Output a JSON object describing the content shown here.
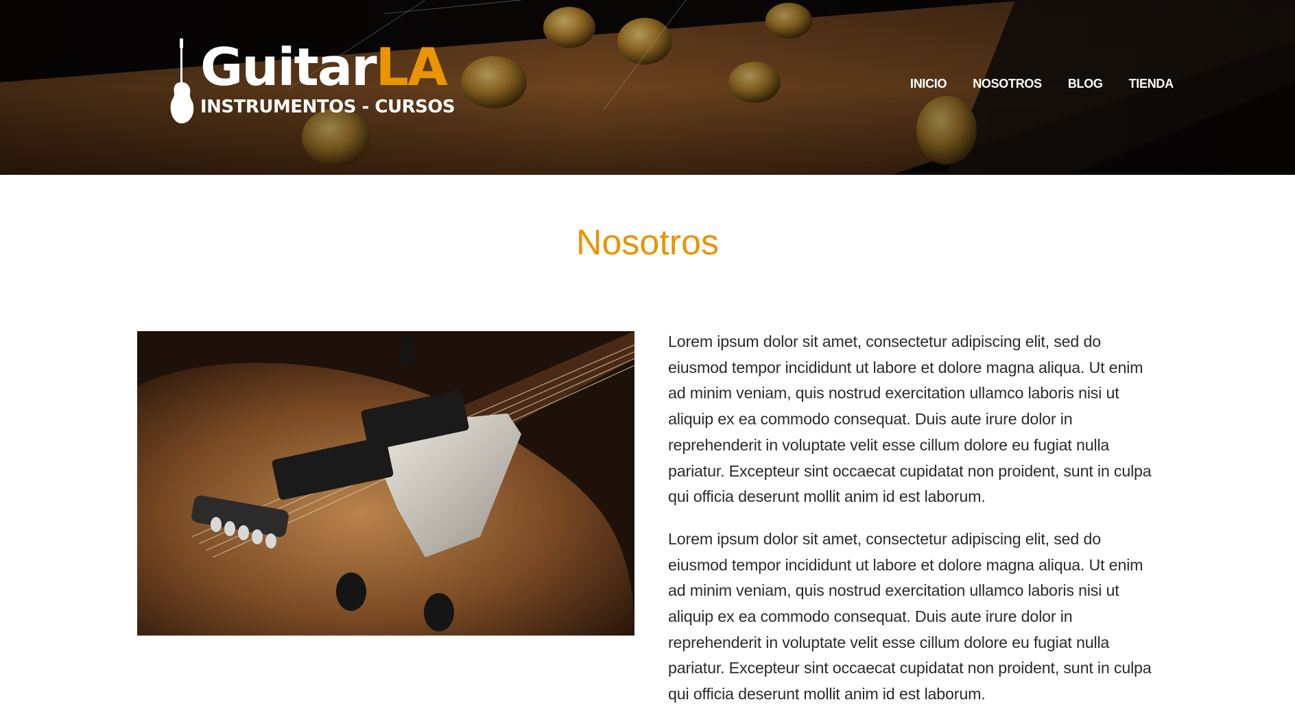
{
  "header": {
    "logo": {
      "word_part1": "Guitar",
      "word_part2": "LA",
      "tagline": "INSTRUMENTOS - CURSOS",
      "icon": "electric-guitar-silhouette-icon"
    },
    "nav": [
      {
        "label": "INICIO"
      },
      {
        "label": "NOSOTROS"
      },
      {
        "label": "BLOG"
      },
      {
        "label": "TIENDA"
      }
    ],
    "background_image": "guitar-headstock-tuning-pegs"
  },
  "main": {
    "title": "Nosotros",
    "image": "electric-guitar-body-closeup",
    "paragraphs": [
      "Lorem ipsum dolor sit amet, consectetur adipiscing elit, sed do eiusmod tempor incididunt ut labore et dolore magna aliqua. Ut enim ad minim veniam, quis nostrud exercitation ullamco laboris nisi ut aliquip ex ea commodo consequat. Duis aute irure dolor in reprehenderit in voluptate velit esse cillum dolore eu fugiat nulla pariatur. Excepteur sint occaecat cupidatat non proident, sunt in culpa qui officia deserunt mollit anim id est laborum.",
      "Lorem ipsum dolor sit amet, consectetur adipiscing elit, sed do eiusmod tempor incididunt ut labore et dolore magna aliqua. Ut enim ad minim veniam, quis nostrud exercitation ullamco laboris nisi ut aliquip ex ea commodo consequat. Duis aute irure dolor in reprehenderit in voluptate velit esse cillum dolore eu fugiat nulla pariatur. Excepteur sint occaecat cupidatat non proident, sunt in culpa qui officia deserunt mollit anim id est laborum."
    ]
  },
  "colors": {
    "accent": "#e99401",
    "text": "#2b2b2b",
    "header_bg": "#0e0a08"
  }
}
